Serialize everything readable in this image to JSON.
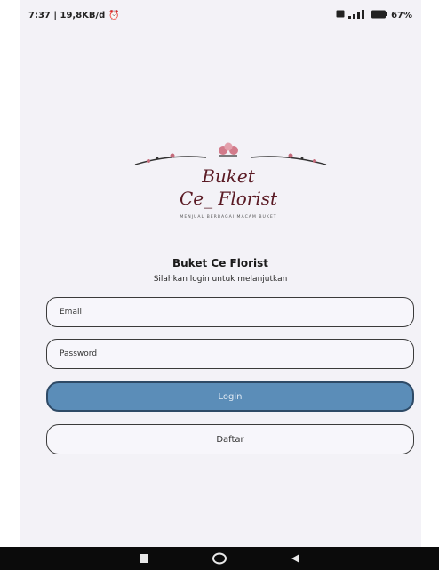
{
  "status_bar": {
    "time_speed": "7:37 | 19,8KB/d",
    "battery": "67%"
  },
  "logo": {
    "line1": "Buket",
    "line2": "Ce_ Florist",
    "tagline": "MENJUAL BERBAGAI MACAM BUKET"
  },
  "title": "Buket Ce Florist",
  "subtitle": "Silahkan login untuk melanjutkan",
  "form": {
    "email_placeholder": "Email",
    "password_placeholder": "Password"
  },
  "buttons": {
    "login": "Login",
    "register": "Daftar"
  },
  "colors": {
    "accent": "#5b8db8",
    "background": "#f3f2f7"
  },
  "icons": {
    "status_left": "alarm-icon",
    "status_right": [
      "sim-icon",
      "signal-icon",
      "battery-icon"
    ],
    "nav": [
      "recents-icon",
      "home-icon",
      "back-icon"
    ]
  }
}
